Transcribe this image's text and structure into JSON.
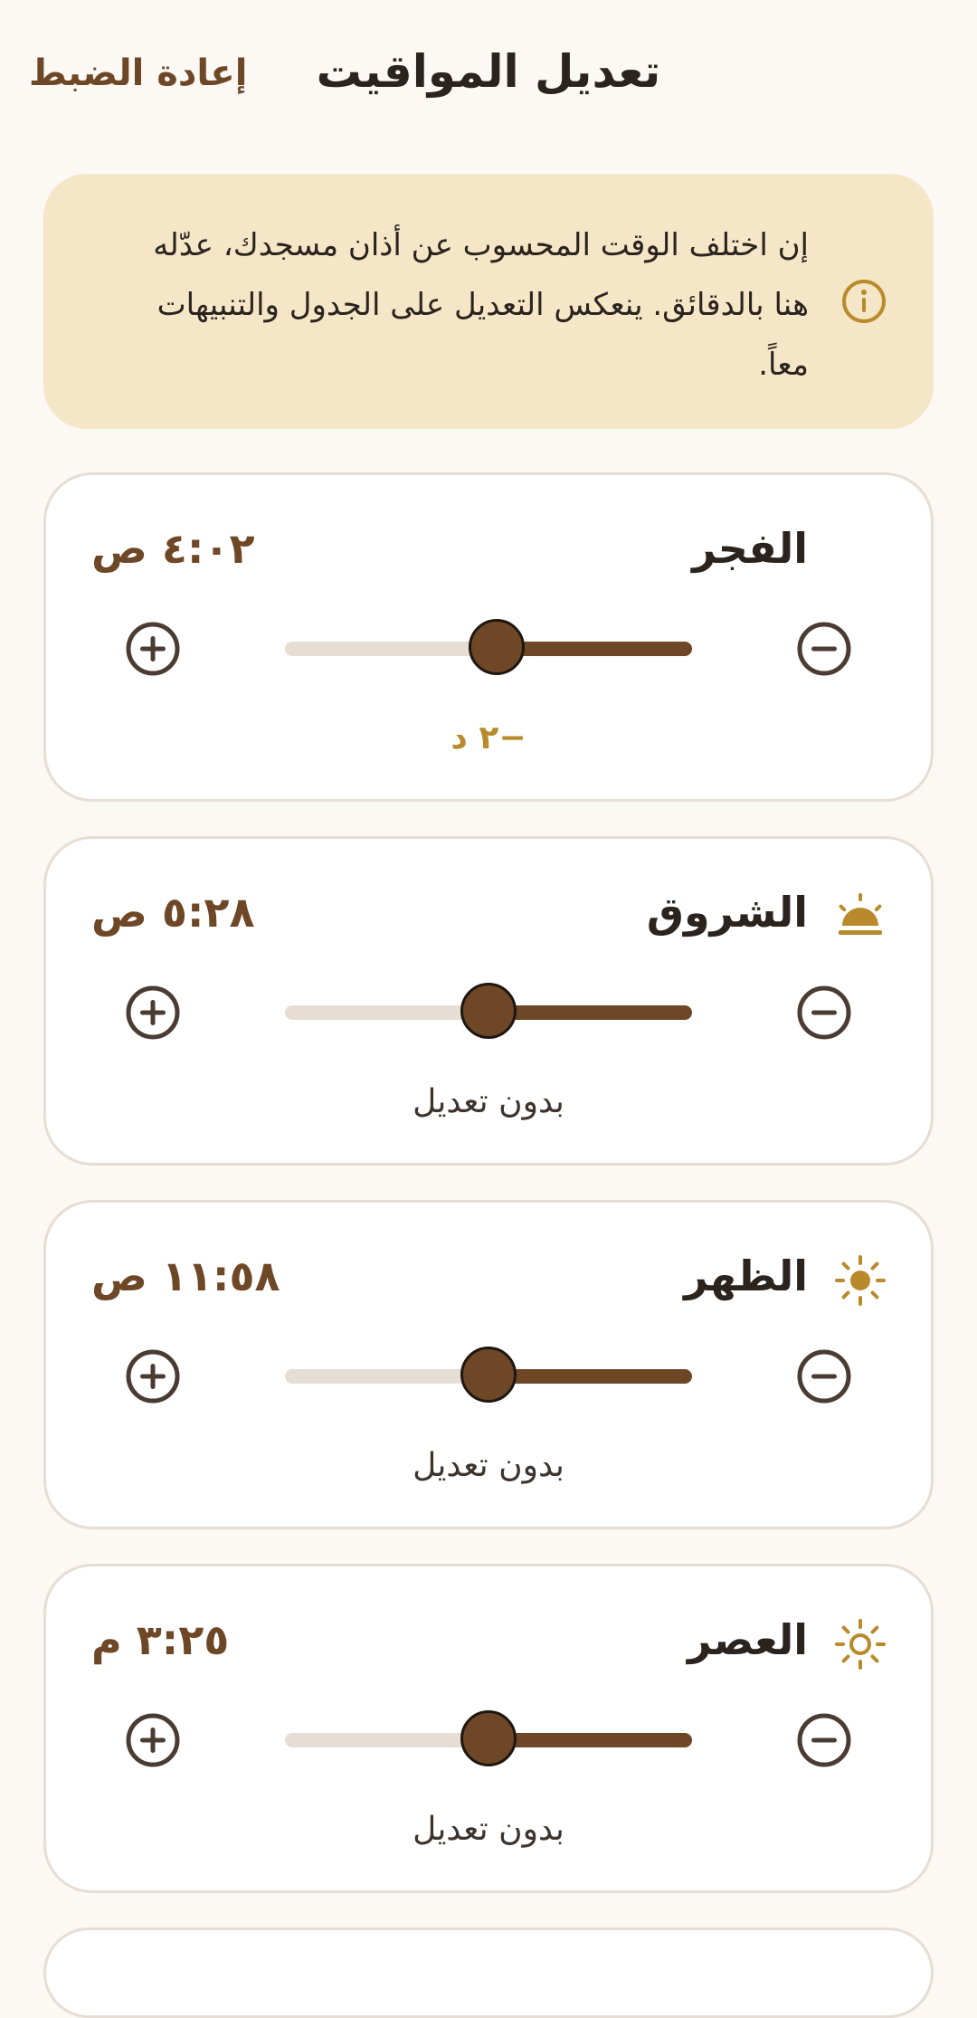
{
  "header": {
    "title": "تعديل المواقيت",
    "reset_label": "إعادة الضبط"
  },
  "banner": {
    "icon": "info-icon",
    "lines": [
      "إن اختلف الوقت المحسوب عن أذان مسجدك، عدّله",
      "هنا بالدقائق. ينعكس التعديل على الجدول والتنبيهات",
      "معاً."
    ]
  },
  "prayers": [
    {
      "name": "الفجر",
      "time": "٤:٠٢ ص",
      "icon": "crescent-moon-icon",
      "offset_minutes": -2,
      "status": "−٢ د",
      "slider_fraction": 0.52
    },
    {
      "name": "الشروق",
      "time": "٥:٢٨ ص",
      "icon": "sunrise-icon",
      "offset_minutes": 0,
      "status": "بدون تعديل",
      "slider_fraction": 0.5
    },
    {
      "name": "الظهر",
      "time": "١١:٥٨ ص",
      "icon": "sun-icon",
      "offset_minutes": 0,
      "status": "بدون تعديل",
      "slider_fraction": 0.5
    },
    {
      "name": "العصر",
      "time": "٣:٢٥ م",
      "icon": "sun-outline-icon",
      "offset_minutes": 0,
      "status": "بدون تعديل",
      "slider_fraction": 0.5
    }
  ],
  "colors": {
    "accent": "#6e4726",
    "gold": "#b88a2b",
    "banner_bg": "#f4e6c6",
    "track": "#e6ddd4"
  }
}
